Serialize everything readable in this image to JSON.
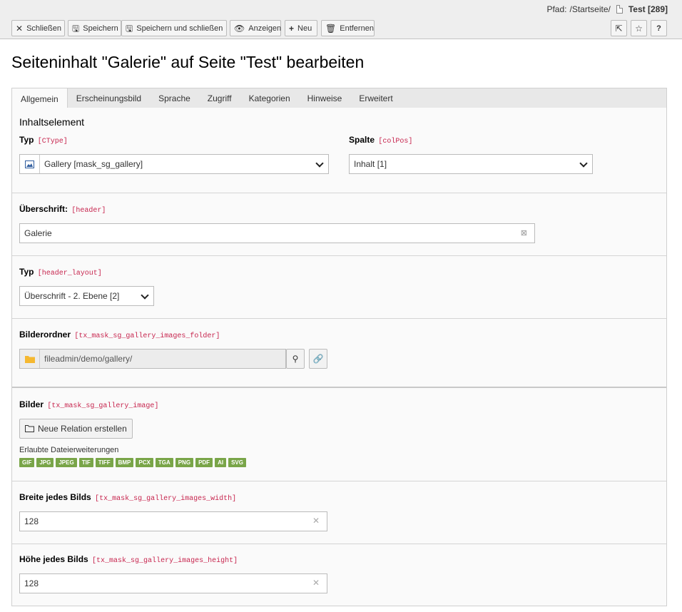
{
  "path": {
    "label": "Pfad:",
    "trail": "/Startseite/",
    "page": "Test [289]"
  },
  "toolbar": {
    "close": "Schließen",
    "save": "Speichern",
    "save_close": "Speichern und schließen",
    "view": "Anzeigen",
    "new": "Neu",
    "remove": "Entfernen",
    "help": "?"
  },
  "title": "Seiteninhalt \"Galerie\" auf Seite \"Test\" bearbeiten",
  "tabs": [
    "Allgemein",
    "Erscheinungsbild",
    "Sprache",
    "Zugriff",
    "Kategorien",
    "Hinweise",
    "Erweitert"
  ],
  "section_title": "Inhaltselement",
  "ctype": {
    "label": "Typ",
    "code": "[CType]",
    "value": "Gallery [mask_sg_gallery]"
  },
  "colpos": {
    "label": "Spalte",
    "code": "[colPos]",
    "value": "Inhalt [1]"
  },
  "header": {
    "label": "Überschrift:",
    "code": "[header]",
    "value": "Galerie"
  },
  "header_layout": {
    "label": "Typ",
    "code": "[header_layout]",
    "value": "Überschrift - 2. Ebene [2]"
  },
  "images_folder": {
    "label": "Bilderordner",
    "code": "[tx_mask_sg_gallery_images_folder]",
    "value": "fileadmin/demo/gallery/"
  },
  "images": {
    "label": "Bilder",
    "code": "[tx_mask_sg_gallery_image]",
    "button": "Neue Relation erstellen",
    "allowed_label": "Erlaubte Dateierweiterungen",
    "extensions": [
      "GIF",
      "JPG",
      "JPEG",
      "TIF",
      "TIFF",
      "BMP",
      "PCX",
      "TGA",
      "PNG",
      "PDF",
      "AI",
      "SVG"
    ]
  },
  "width": {
    "label": "Breite jedes Bilds",
    "code": "[tx_mask_sg_gallery_images_width]",
    "value": "128"
  },
  "height": {
    "label": "Höhe jedes Bilds",
    "code": "[tx_mask_sg_gallery_images_height]",
    "value": "128"
  }
}
